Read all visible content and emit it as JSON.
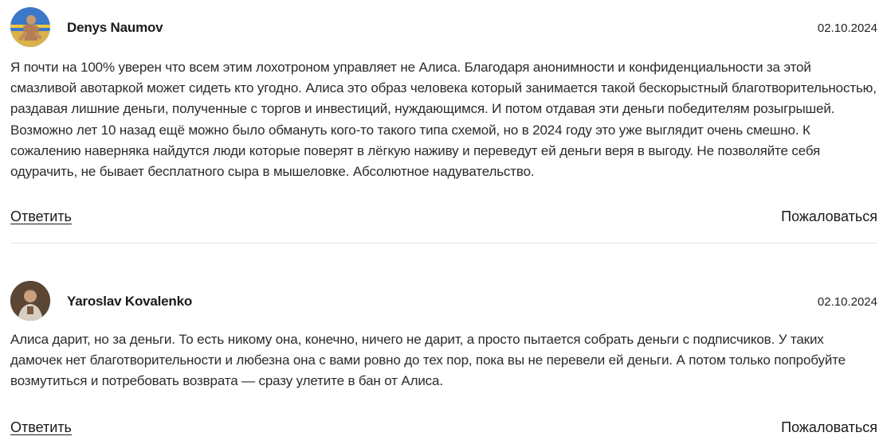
{
  "comments": [
    {
      "author": "Denys Naumov",
      "date": "02.10.2024",
      "text": "Я почти на 100% уверен что всем этим лохотроном управляет не Алиса. Благодаря анонимности и конфиденциальности за этой смазливой авотаркой может сидеть кто угодно. Алиса это образ человека который занимается такой бескорыстный благотворительностью, раздавая лишние деньги, полученные с торгов и инвестиций, нуждающимся. И потом отдавая эти деньги победителям розыгрышей. Возможно лет 10 назад ещё можно было обмануть кого-то такого типа схемой, но в 2024 году это уже выглядит очень смешно. К сожалению наверняка найдутся люди которые поверят в лёгкую наживу и переведут ей деньги веря в выгоду. Не позволяйте себя одурачить, не бывает бесплатного сыра в мышеловке. Абсолютное надувательство.",
      "reply_label": "Ответить",
      "report_label": "Пожаловаться"
    },
    {
      "author": "Yaroslav Kovalenko",
      "date": "02.10.2024",
      "text": "Алиса дарит, но за деньги. То есть никому она, конечно, ничего не дарит, а просто пытается собрать деньги с подписчиков. У таких дамочек нет благотворительности и любезна она с вами ровно до тех пор, пока вы не перевели ей деньги. А потом только попробуйте возмутиться и потребовать возврата — сразу улетите в бан от Алиса.",
      "reply_label": "Ответить",
      "report_label": "Пожаловаться"
    }
  ]
}
